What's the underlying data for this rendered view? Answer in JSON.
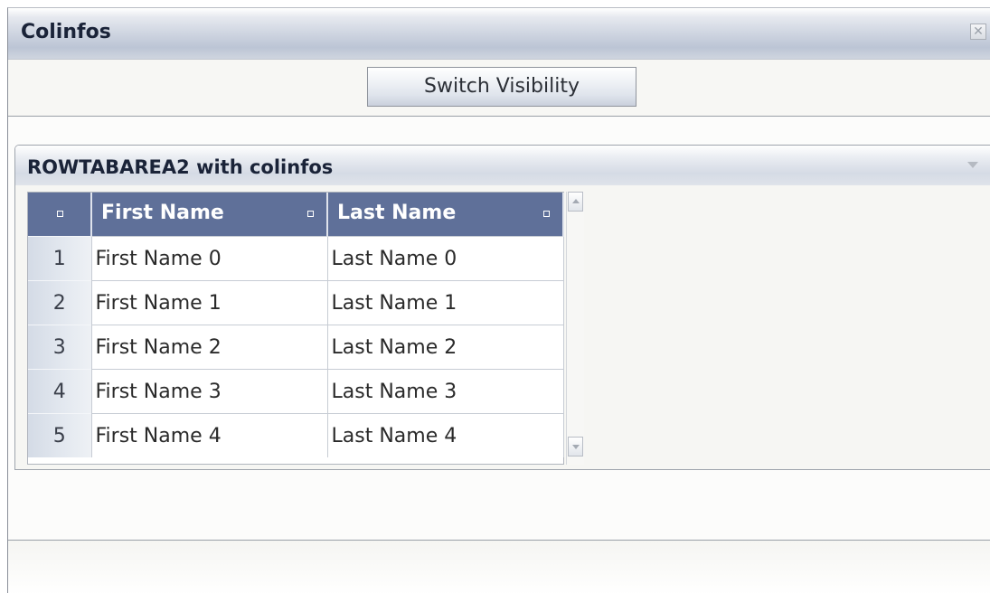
{
  "window": {
    "title": "Colinfos",
    "close_icon": "close-icon"
  },
  "toolbar": {
    "switch_visibility_label": "Switch Visibility"
  },
  "rowarea": {
    "title": "ROWTABAREA2 with colinfos",
    "collapse_icon": "chevron-down-icon"
  },
  "table": {
    "columns": [
      "First Name",
      "Last Name"
    ],
    "rows": [
      {
        "index": "1",
        "first": "First Name 0",
        "last": "Last Name 0"
      },
      {
        "index": "2",
        "first": "First Name 1",
        "last": "Last Name 1"
      },
      {
        "index": "3",
        "first": "First Name 2",
        "last": "Last Name 2"
      },
      {
        "index": "4",
        "first": "First Name 3",
        "last": "Last Name 3"
      },
      {
        "index": "5",
        "first": "First Name 4",
        "last": "Last Name 4"
      }
    ]
  },
  "colors": {
    "header_bg": "#5f7099",
    "title_text": "#1a2338"
  }
}
